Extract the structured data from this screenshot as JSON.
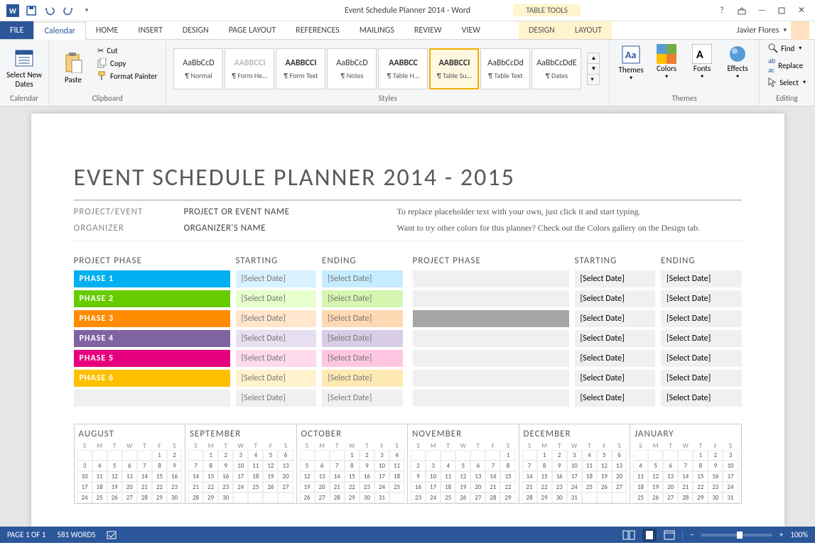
{
  "titlebar": {
    "title": "Event Schedule Planner 2014 - Word",
    "table_tools": "TABLE TOOLS"
  },
  "tabs": {
    "file": "FILE",
    "calendar": "Calendar",
    "home": "HOME",
    "insert": "INSERT",
    "design": "DESIGN",
    "page_layout": "PAGE LAYOUT",
    "references": "REFERENCES",
    "mailings": "MAILINGS",
    "review": "REVIEW",
    "view": "VIEW",
    "tt_design": "DESIGN",
    "tt_layout": "LAYOUT"
  },
  "user": {
    "name": "Javier Flores"
  },
  "ribbon": {
    "calendar": {
      "select_dates": "Select New Dates",
      "group": "Calendar"
    },
    "clipboard": {
      "paste": "Paste",
      "cut": "Cut",
      "copy": "Copy",
      "format_painter": "Format Painter",
      "group": "Clipboard"
    },
    "styles": {
      "items": [
        {
          "prev": "AaBbCcD",
          "name": "¶ Normal"
        },
        {
          "prev": "AABBCCI",
          "name": "¶ Form He..."
        },
        {
          "prev": "AABBCCI",
          "name": "¶ Form Text"
        },
        {
          "prev": "AaBbCcD",
          "name": "¶ Notes"
        },
        {
          "prev": "AABBCC",
          "name": "¶ Table H..."
        },
        {
          "prev": "AABBCCI",
          "name": "¶ Table Su..."
        },
        {
          "prev": "AaBbCcDd",
          "name": "¶ Table Text"
        },
        {
          "prev": "AaBbCcDdE",
          "name": "¶ Dates"
        }
      ],
      "group": "Styles"
    },
    "themes": {
      "themes": "Themes",
      "colors": "Colors",
      "fonts": "Fonts",
      "effects": "Effects",
      "group": "Themes"
    },
    "editing": {
      "find": "Find",
      "replace": "Replace",
      "select": "Select",
      "group": "Editing"
    }
  },
  "doc": {
    "title": "EVENT SCHEDULE PLANNER 2014 - 2015",
    "meta": {
      "project_label": "PROJECT/EVENT",
      "project_val": "PROJECT OR EVENT NAME",
      "organizer_label": "ORGANIZER",
      "organizer_val": "ORGANIZER'S NAME",
      "help1": "To replace placeholder text with your own, just click it and start typing.",
      "help2": "Want to try other colors for this planner? Check out the Colors gallery on the Design tab."
    },
    "phase_headers": {
      "phase": "PROJECT PHASE",
      "start": "STARTING",
      "end": "ENDING"
    },
    "select_date": "[Select Date]",
    "left_phases": [
      {
        "name": "PHASE 1",
        "bg": "#00b0f0",
        "d1": "#d9f2ff",
        "d2": "#c6ecff"
      },
      {
        "name": "PHASE 2",
        "bg": "#66cc00",
        "d1": "#e6ffcc",
        "d2": "#d5f5b0"
      },
      {
        "name": "PHASE 3",
        "bg": "#ff8c00",
        "d1": "#ffe6cc",
        "d2": "#ffd9b3"
      },
      {
        "name": "PHASE 4",
        "bg": "#8064a2",
        "d1": "#e6dff0",
        "d2": "#d9cce6"
      },
      {
        "name": "PHASE 5",
        "bg": "#e6007e",
        "d1": "#ffd9ec",
        "d2": "#ffc6e2"
      },
      {
        "name": "PHASE 6",
        "bg": "#ffc000",
        "d1": "#fff2cc",
        "d2": "#ffe9b3"
      },
      {
        "name": "",
        "bg": "",
        "d1": "#f0f0f0",
        "d2": "#f0f0f0"
      }
    ],
    "right_phases": [
      {
        "grey": false
      },
      {
        "grey": false
      },
      {
        "grey": true
      },
      {
        "grey": false
      },
      {
        "grey": false
      },
      {
        "grey": false
      },
      {
        "grey": false
      }
    ],
    "months": [
      {
        "name": "AUGUST",
        "start": 5,
        "days": 31
      },
      {
        "name": "SEPTEMBER",
        "start": 1,
        "days": 30
      },
      {
        "name": "OCTOBER",
        "start": 3,
        "days": 31
      },
      {
        "name": "NOVEMBER",
        "start": 6,
        "days": 30
      },
      {
        "name": "DECEMBER",
        "start": 1,
        "days": 31
      },
      {
        "name": "JANUARY",
        "start": 4,
        "days": 31
      }
    ],
    "dow": [
      "S",
      "M",
      "T",
      "W",
      "T",
      "F",
      "S"
    ]
  },
  "statusbar": {
    "page": "PAGE 1 OF 1",
    "words": "581 WORDS",
    "zoom": "100%"
  }
}
